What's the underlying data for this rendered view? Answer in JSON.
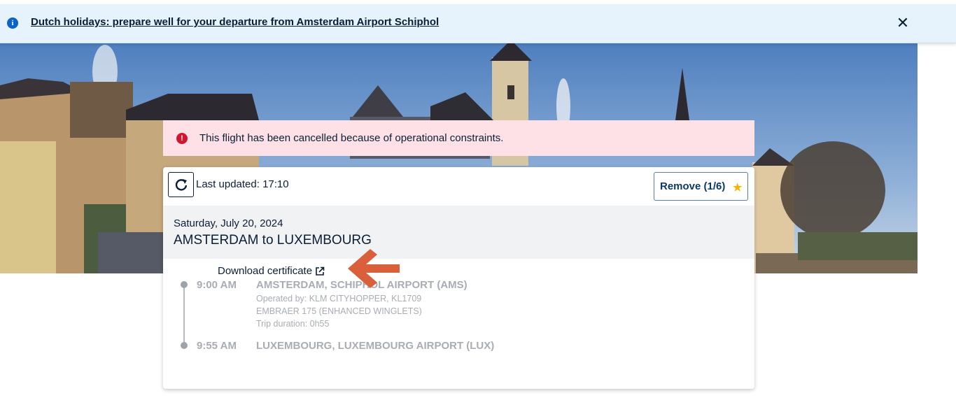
{
  "announcement": {
    "text": "Dutch holidays: prepare well for your departure from Amsterdam Airport Schiphol",
    "info_icon": "info-icon",
    "close_icon": "close-icon"
  },
  "alert": {
    "text": "This flight has been cancelled because of operational constraints.",
    "icon": "alert-icon",
    "color": "#fde1e6"
  },
  "card": {
    "last_updated": "Last updated: 17:10",
    "remove_label": "Remove (1/6)",
    "date": "Saturday, July 20, 2024",
    "route": "AMSTERDAM to LUXEMBOURG",
    "download_label": "Download certificate",
    "segments": [
      {
        "time": "9:00 AM",
        "airport": "AMSTERDAM, SCHIPHOL AIRPORT (AMS)",
        "operated_by": "Operated by: KLM CITYHOPPER, KL1709",
        "aircraft": "EMBRAER 175 (ENHANCED WINGLETS)",
        "duration": "Trip duration: 0h55"
      },
      {
        "time": "9:55 AM",
        "airport": "LUXEMBOURG, LUXEMBOURG AIRPORT (LUX)"
      }
    ]
  },
  "colors": {
    "banner_bg": "#e6f3fd",
    "brand_dark": "#0b1f35",
    "star": "#f5b400",
    "annotation_arrow": "#d9603b"
  }
}
